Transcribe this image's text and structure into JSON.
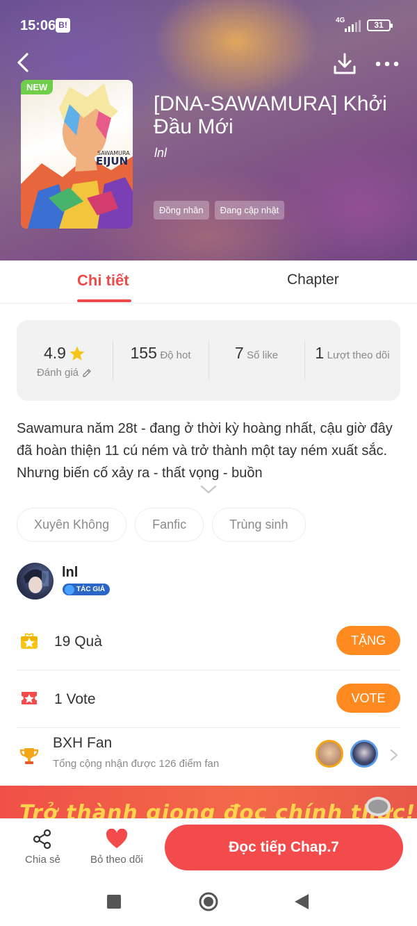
{
  "status": {
    "time": "15:06",
    "notification": "B!",
    "network": "4G",
    "battery": "31"
  },
  "book": {
    "badge": "NEW",
    "title": "[DNA-SAWAMURA] Khởi Đầu Mới",
    "author": "lnl",
    "hero_tags": [
      "Đồng nhân",
      "Đang cập nhật"
    ],
    "cover_text_top": "SAWAMURA",
    "cover_text_main": "EIJUN"
  },
  "tabs": {
    "detail": "Chi tiết",
    "chapter": "Chapter"
  },
  "stats": [
    {
      "value": "4.9",
      "label": "Đánh giá"
    },
    {
      "value": "155",
      "label": "Độ hot"
    },
    {
      "value": "7",
      "label": "Số like"
    },
    {
      "value": "1",
      "label": "Lượt theo dõi"
    }
  ],
  "description": "Sawamura năm 28t - đang ở thời kỳ hoàng nhất, cậu giờ đây đã hoàn thiện 11 cú ném và trở thành một tay ném xuất sắc. Nhưng biến cố xảy ra - thất vọng - buồn",
  "genres": [
    "Xuyên Không",
    "Fanfic",
    "Trùng sinh"
  ],
  "author_card": {
    "name": "lnl",
    "badge": "TÁC GIẢ"
  },
  "gifts": {
    "text": "19 Quà",
    "button": "TẶNG"
  },
  "votes": {
    "text": "1 Vote",
    "button": "VOTE"
  },
  "fan_ranking": {
    "title": "BXH Fan",
    "subtitle": "Tổng cộng nhận được 126 điểm fan"
  },
  "banner": {
    "text": "Trở thành giọng đọc chính thức!"
  },
  "bottom": {
    "share": "Chia sẻ",
    "unfollow": "Bỏ theo dõi",
    "read": "Đọc tiếp Chap.7"
  },
  "colors": {
    "accent": "#f34b4b",
    "orange": "#ff8a1f",
    "gold": "#f5c518"
  }
}
